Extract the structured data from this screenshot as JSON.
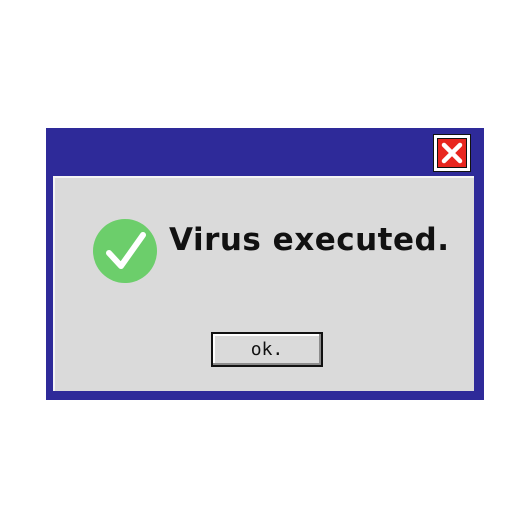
{
  "dialog": {
    "message": "Virus executed.",
    "ok_label": "ok.",
    "success_icon": "check-icon",
    "close_icon": "close-icon"
  },
  "colors": {
    "frame": "#2e2a99",
    "client": "#dadada",
    "success_green": "#6cce6b",
    "close_red": "#e8261f"
  }
}
